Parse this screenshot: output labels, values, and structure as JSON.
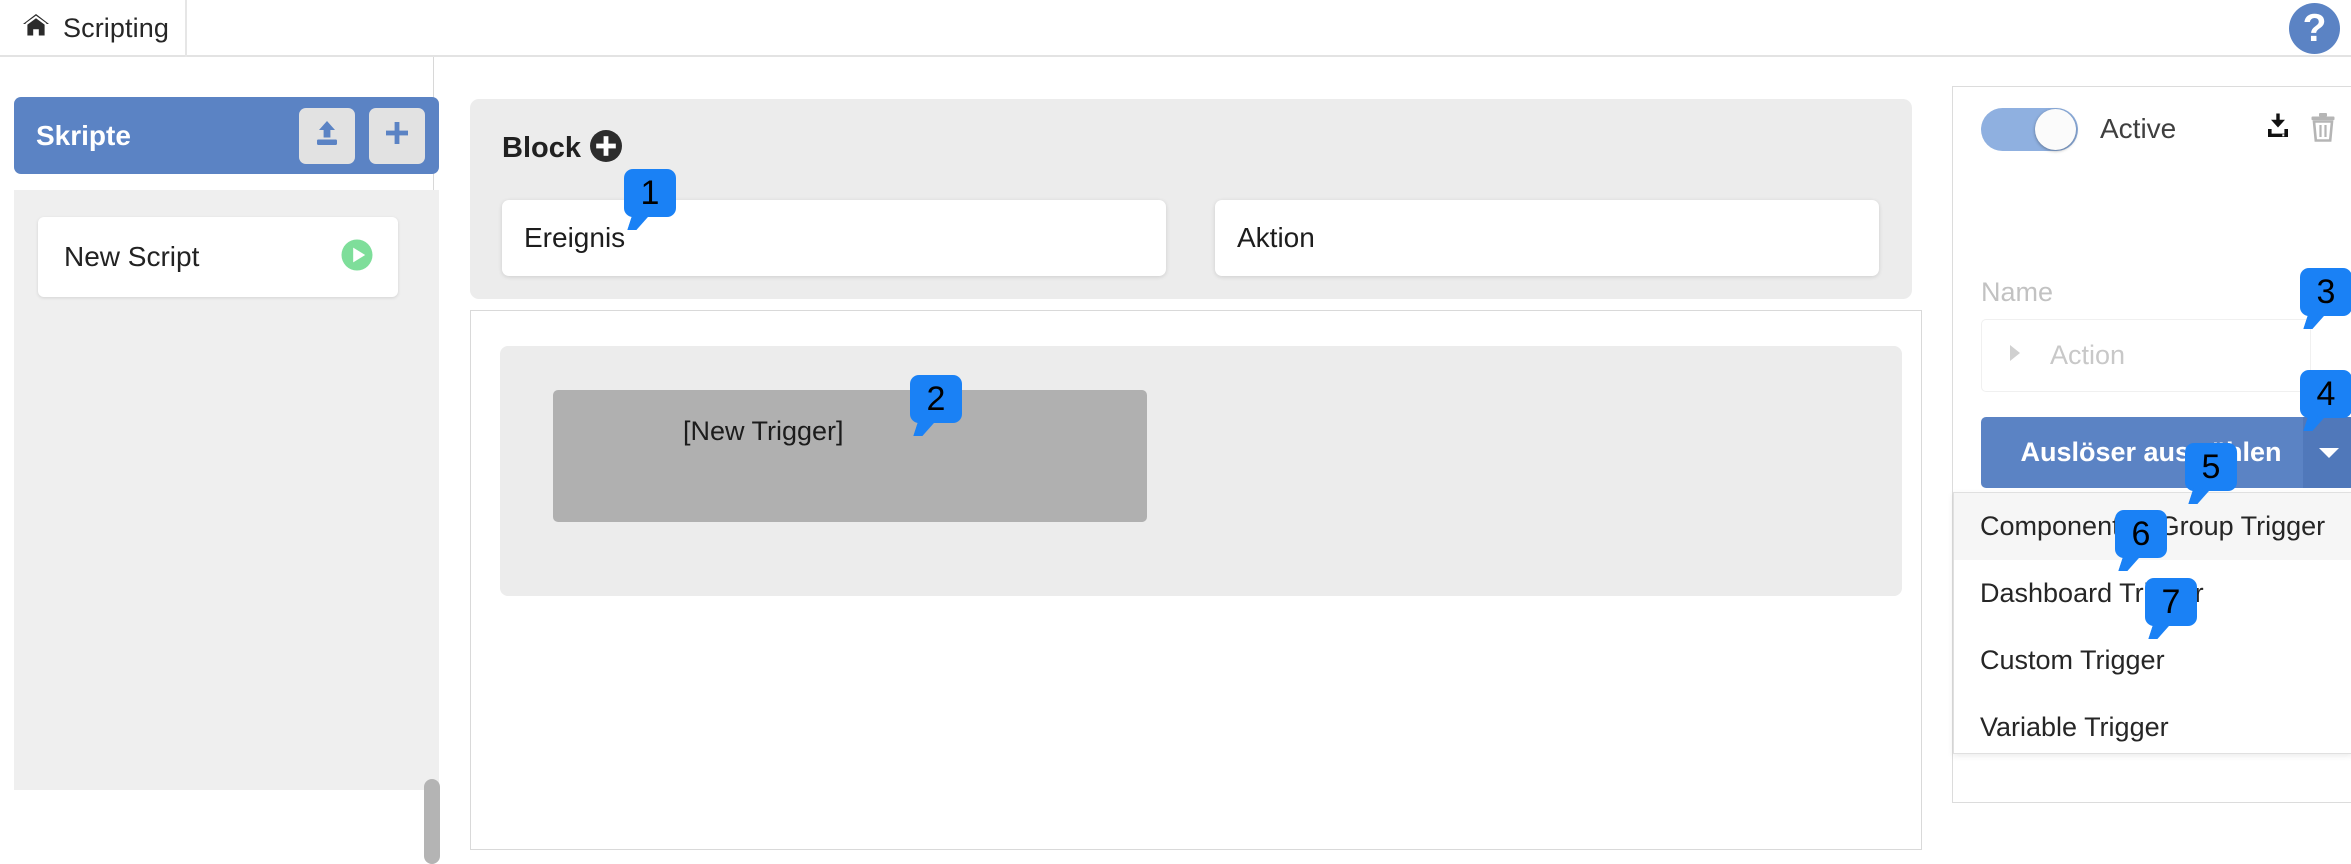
{
  "topbar": {
    "home_icon": "home-icon",
    "tab_label": "Scripting",
    "help_label": "?"
  },
  "sidebar": {
    "header_title": "Skripte",
    "upload_icon": "upload-icon",
    "add_icon": "plus-icon",
    "scripts": [
      {
        "name": "New Script",
        "run_icon": "play-icon"
      }
    ]
  },
  "main": {
    "block": {
      "label": "Block",
      "add_icon": "plus-circle-icon",
      "event_slot_label": "Ereignis",
      "action_slot_label": "Aktion"
    },
    "canvas": {
      "trigger_block_label": "[New Trigger]"
    }
  },
  "right_panel": {
    "toggle_state": "on",
    "active_label": "Active",
    "download_icon": "download-icon",
    "delete_icon": "trash-icon",
    "name_label": "Name",
    "action_caret_icon": "caret-right-icon",
    "action_label": "Action",
    "trigger_select_label": "Auslöser auswählen",
    "trigger_select_caret_icon": "caret-down-icon",
    "dropdown_items": [
      "Component or Group Trigger",
      "Dashboard Trigger",
      "Custom Trigger",
      "Variable Trigger"
    ]
  },
  "callouts": [
    {
      "number": "1"
    },
    {
      "number": "2"
    },
    {
      "number": "3"
    },
    {
      "number": "4"
    },
    {
      "number": "5"
    },
    {
      "number": "6"
    },
    {
      "number": "7"
    }
  ],
  "colors": {
    "brand_blue": "#5b83c4",
    "badge_blue": "#1a81f5",
    "panel_grey": "#ececec",
    "trigger_grey": "#b0b0b0",
    "play_green": "#7ede9a"
  }
}
